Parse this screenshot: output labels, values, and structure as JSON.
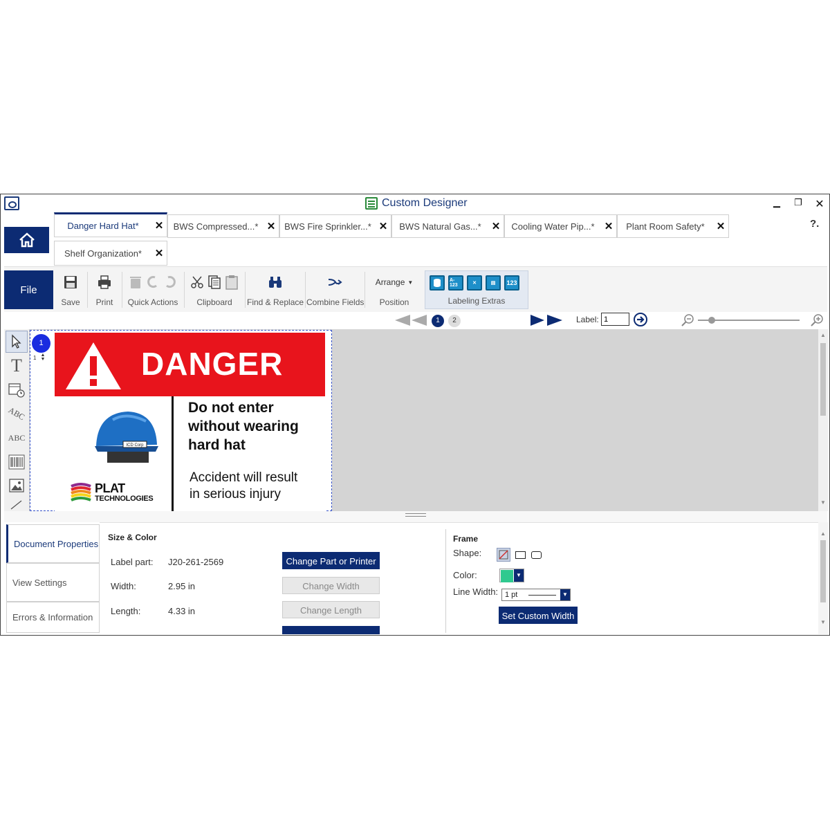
{
  "window": {
    "title": "Custom Designer",
    "help": "?."
  },
  "tabs": [
    {
      "label": "Danger Hard Hat*",
      "active": true
    },
    {
      "label": "BWS Compressed...*"
    },
    {
      "label": "BWS Fire Sprinkler...*"
    },
    {
      "label": "BWS Natural Gas...*"
    },
    {
      "label": "Cooling Water Pip...*"
    },
    {
      "label": "Plant Room Safety*"
    },
    {
      "label": "Shelf Organization*"
    }
  ],
  "ribbon": {
    "file": "File",
    "save": "Save",
    "print": "Print",
    "quick_actions": "Quick Actions",
    "clipboard": "Clipboard",
    "find_replace": "Find & Replace",
    "combine_fields": "Combine Fields",
    "arrange": "Arrange",
    "position": "Position",
    "labeling_extras": "Labeling Extras",
    "labeling_extras_icons": [
      "A-123",
      "123"
    ]
  },
  "nav": {
    "pages": [
      "1",
      "2"
    ],
    "current_page": "1",
    "label_text": "Label:",
    "label_value": "1",
    "zoom_level": 0.1
  },
  "canvas": {
    "page_badge": "1",
    "row_marker": "1",
    "sign": {
      "header": "DANGER",
      "message_bold": [
        "Do not enter",
        "without wearing",
        "hard hat"
      ],
      "message_normal": [
        "Accident will result",
        "in serious injury"
      ],
      "helmet_tag": "ICD Corp",
      "brand_name": "PLAT",
      "brand_sub": "TECHNOLOGIES",
      "colors": {
        "header_bg": "#e8141c",
        "helmet": "#1e6fc4"
      }
    }
  },
  "tools": [
    "select-tool",
    "text-tool",
    "date-tool",
    "curved-text-tool",
    "abc-tool",
    "barcode-tool",
    "image-tool",
    "shape-tool"
  ],
  "panel": {
    "side_tabs": [
      "Document Properties",
      "View Settings",
      "Errors & Information"
    ],
    "size_color": {
      "heading": "Size & Color",
      "label_part_label": "Label part:",
      "label_part_value": "J20-261-2569",
      "width_label": "Width:",
      "width_value": "2.95  in",
      "length_label": "Length:",
      "length_value": "4.33  in",
      "change_part_button": "Change Part or Printer",
      "change_width_button": "Change Width",
      "change_length_button": "Change Length"
    },
    "frame": {
      "heading": "Frame",
      "shape_label": "Shape:",
      "color_label": "Color:",
      "color_value": "#2fc98f",
      "line_width_label": "Line Width:",
      "line_width_value": "1 pt",
      "custom_width_button": "Set Custom Width"
    }
  },
  "theme": {
    "accent": "#0c2b73",
    "title_color": "#1b3a7a",
    "canvas_bg": "#d4d4d4"
  }
}
